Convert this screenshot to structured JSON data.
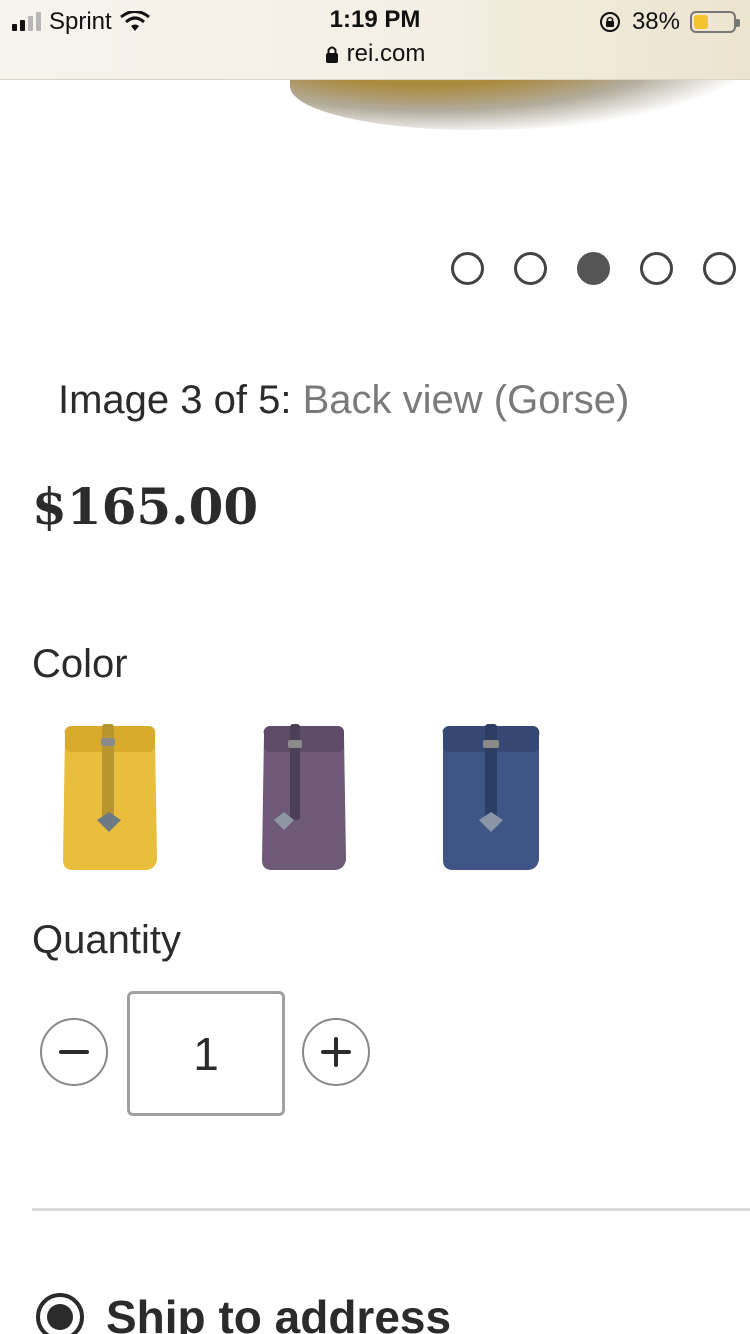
{
  "status_bar": {
    "carrier": "Sprint",
    "time": "1:19 PM",
    "url": "rei.com",
    "battery": "38%",
    "battery_level": 0.38,
    "icons": [
      "signal-icon",
      "wifi-icon",
      "lock-icon",
      "rotation-lock-icon",
      "battery-icon"
    ]
  },
  "carousel": {
    "total": 5,
    "active_index": 3,
    "caption_prefix": "Image 3 of 5:",
    "caption_desc": "Back view (Gorse)"
  },
  "product": {
    "price": "$165.00"
  },
  "color": {
    "label": "Color",
    "swatches": [
      {
        "name": "Gorse",
        "color": "#e8be3c"
      },
      {
        "name": "Purple",
        "color": "#6e5a78"
      },
      {
        "name": "Navy",
        "color": "#3f5585"
      }
    ]
  },
  "quantity": {
    "label": "Quantity",
    "value": "1"
  },
  "shipping": {
    "option": "Ship to address",
    "selected": true
  }
}
